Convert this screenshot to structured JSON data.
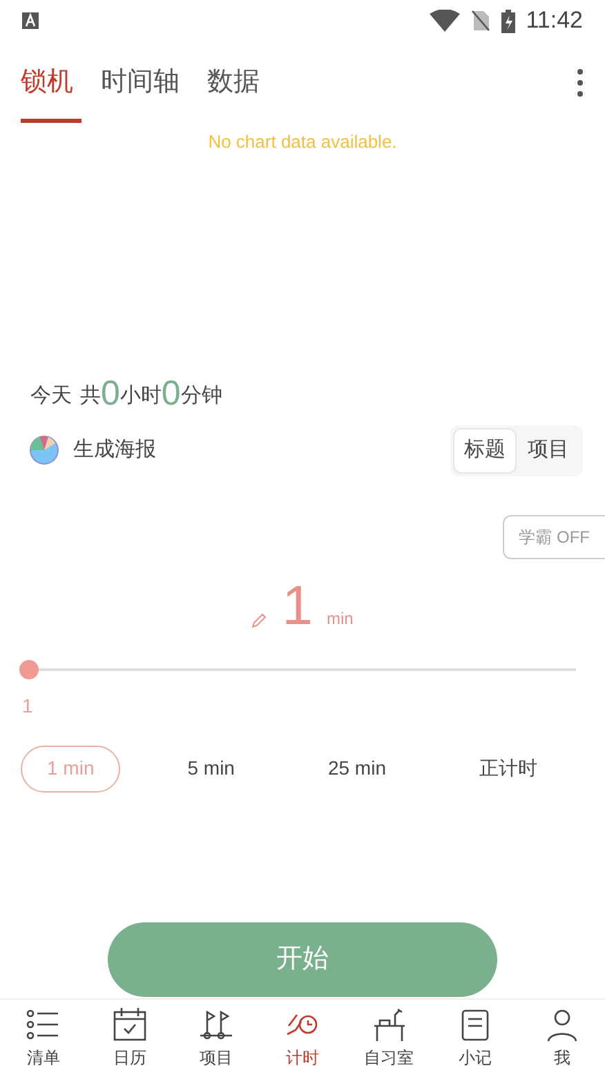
{
  "status_bar": {
    "time": "11:42"
  },
  "tabs": [
    {
      "label": "锁机",
      "selected": true
    },
    {
      "label": "时间轴",
      "selected": false
    },
    {
      "label": "数据",
      "selected": false
    }
  ],
  "chart": {
    "message": "No chart data available."
  },
  "summary": {
    "prefix": "今天",
    "total_label": "共",
    "hours": "0",
    "hours_unit": "小时",
    "minutes": "0",
    "minutes_unit": "分钟"
  },
  "poster": {
    "label": "生成海报"
  },
  "view_toggle": [
    {
      "label": "标题",
      "selected": true
    },
    {
      "label": "项目",
      "selected": false
    }
  ],
  "study_mode": {
    "label": "学霸 OFF"
  },
  "duration": {
    "value": "1",
    "unit": "min"
  },
  "slider": {
    "level": 0,
    "reading": "1"
  },
  "presets": [
    {
      "label": "1 min",
      "selected": true
    },
    {
      "label": "5 min",
      "selected": false
    },
    {
      "label": "25 min",
      "selected": false
    },
    {
      "label": "正计时",
      "selected": false
    }
  ],
  "start_button": {
    "label": "开始"
  },
  "nav": [
    {
      "kind": "list",
      "label": "清单",
      "selected": false
    },
    {
      "kind": "calendar",
      "label": "日历",
      "selected": false
    },
    {
      "kind": "flags",
      "label": "项目",
      "selected": false
    },
    {
      "kind": "timer",
      "label": "计时",
      "selected": true
    },
    {
      "kind": "desk",
      "label": "自习室",
      "selected": false
    },
    {
      "kind": "note",
      "label": "小记",
      "selected": false
    },
    {
      "kind": "person",
      "label": "我",
      "selected": false
    }
  ]
}
